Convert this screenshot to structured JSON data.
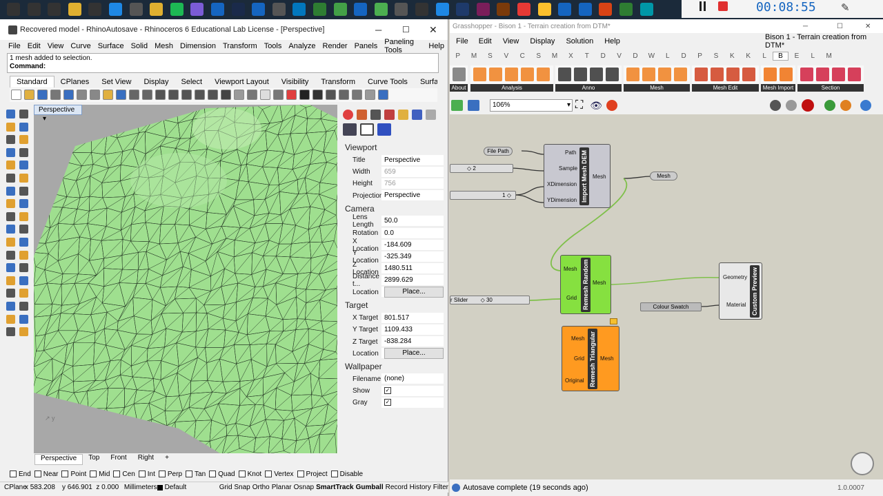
{
  "taskbar": {
    "rec_time": "00:08:55",
    "icons": [
      "start-icon",
      "search-icon",
      "task-view-icon",
      "file-explorer-icon",
      "store-icon",
      "edge-icon",
      "app-icon",
      "folder-icon",
      "spotify-icon",
      "viber-icon",
      "mail-icon",
      "steam-icon",
      "photos-icon",
      "settings-icon",
      "icon-O",
      "icon-Q",
      "app-icon-2",
      "app-icon-3",
      "app-icon-4",
      "rhino-icon",
      "grasshopper-icon",
      "revit-icon",
      "photoshop-icon",
      "indesign-icon",
      "illustrator-icon",
      "youtube-icon",
      "chrome-icon",
      "outlook-icon",
      "word-icon",
      "powerpoint-icon",
      "excel-icon",
      "camera-icon"
    ]
  },
  "rhino": {
    "title": "Recovered model - RhinoAutosave - Rhinoceros 6 Educational Lab License - [Perspective]",
    "menu": [
      "File",
      "Edit",
      "View",
      "Curve",
      "Surface",
      "Solid",
      "Mesh",
      "Dimension",
      "Transform",
      "Tools",
      "Analyze",
      "Render",
      "Panels",
      "Paneling Tools",
      "Help"
    ],
    "history_line": "1 mesh added to selection.",
    "command_label": "Command:",
    "toolbar_tabs": [
      "Standard",
      "CPlanes",
      "Set View",
      "Display",
      "Select",
      "Viewport Layout",
      "Visibility",
      "Transform",
      "Curve Tools",
      "Surface Toc"
    ],
    "viewport_title": "Perspective",
    "view_tabs": [
      "Perspective",
      "Top",
      "Front",
      "Right"
    ],
    "add_tab": "+",
    "props": {
      "viewport_header": "Viewport",
      "viewport": [
        {
          "k": "Title",
          "v": "Perspective"
        },
        {
          "k": "Width",
          "v": "659",
          "dim": true
        },
        {
          "k": "Height",
          "v": "756",
          "dim": true
        },
        {
          "k": "Projection",
          "v": "Perspective"
        }
      ],
      "camera_header": "Camera",
      "camera": [
        {
          "k": "Lens Length",
          "v": "50.0"
        },
        {
          "k": "Rotation",
          "v": "0.0"
        },
        {
          "k": "X Location",
          "v": "-184.609"
        },
        {
          "k": "Y Location",
          "v": "-325.349"
        },
        {
          "k": "Z Location",
          "v": "1480.511"
        },
        {
          "k": "Distance t...",
          "v": "2899.629"
        },
        {
          "k": "Location",
          "v": "Place...",
          "button": true
        }
      ],
      "target_header": "Target",
      "target": [
        {
          "k": "X Target",
          "v": "801.517"
        },
        {
          "k": "Y Target",
          "v": "1109.433"
        },
        {
          "k": "Z Target",
          "v": "-838.284"
        },
        {
          "k": "Location",
          "v": "Place...",
          "button": true
        }
      ],
      "wallpaper_header": "Wallpaper",
      "wallpaper": [
        {
          "k": "Filename",
          "v": "(none)"
        },
        {
          "k": "Show",
          "v": "checked"
        },
        {
          "k": "Gray",
          "v": "checked"
        }
      ]
    },
    "osnaps": [
      "End",
      "Near",
      "Point",
      "Mid",
      "Cen",
      "Int",
      "Perp",
      "Tan",
      "Quad",
      "Knot",
      "Vertex",
      "Project",
      "Disable"
    ],
    "status": {
      "cplane": "CPlane",
      "x": "x 583.208",
      "y": "y 646.901",
      "z": "z 0.000",
      "units": "Millimeters",
      "layer": "Default",
      "toggles": [
        "Grid Snap",
        "Ortho",
        "Planar",
        "Osnap",
        "SmartTrack",
        "Gumball",
        "Record History",
        "Filter"
      ]
    }
  },
  "gh": {
    "window_title": "Grasshopper - Bison 1 - Terrain creation from DTM*",
    "doc_title": "Bison 1 - Terrain creation from DTM*",
    "menu": [
      "File",
      "Edit",
      "View",
      "Display",
      "Solution",
      "Help"
    ],
    "tab_letters": [
      "P",
      "M",
      "S",
      "V",
      "C",
      "S",
      "M",
      "X",
      "T",
      "D",
      "V",
      "D",
      "W",
      "L",
      "D",
      "P",
      "S",
      "K",
      "K",
      "L",
      "B",
      "E",
      "L",
      "M"
    ],
    "active_tab": "B",
    "ribbon_groups": [
      "About",
      "Analysis",
      "Anno",
      "Mesh",
      "Mesh Edit",
      "Mesh Import",
      "Section"
    ],
    "zoom": "106%",
    "components": {
      "file_path": "File Path",
      "slider_a_value": "2",
      "slider_b_value": "1",
      "import_dem_name": "Import Mesh DEM",
      "import_inputs": [
        "Path",
        "Sample",
        "XDimension",
        "YDimension"
      ],
      "import_output": "Mesh",
      "mesh_param": "Mesh",
      "remesh_random_name": "Remesh Random",
      "remesh_random_inputs": [
        "Mesh",
        "Grid"
      ],
      "remesh_random_output": "Mesh",
      "slider_c_label": "r Slider",
      "slider_c_value": "30",
      "colour_swatch": "Colour Swatch",
      "custom_preview_name": "Custom Preview",
      "custom_preview_inputs": [
        "Geometry",
        "Material"
      ],
      "remesh_tri_name": "Remesh Triangular",
      "remesh_tri_inputs": [
        "Mesh",
        "Grid",
        "Original"
      ],
      "remesh_tri_output": "Mesh"
    },
    "status": "Autosave complete (19 seconds ago)",
    "version": "1.0.0007"
  },
  "colors": {
    "mesh_green": "#9fdf8f",
    "gh_green": "#86e040",
    "gh_orange": "#ff9a20",
    "gh_grey": "#c8c8d0",
    "rec_blue": "#1565c0"
  }
}
